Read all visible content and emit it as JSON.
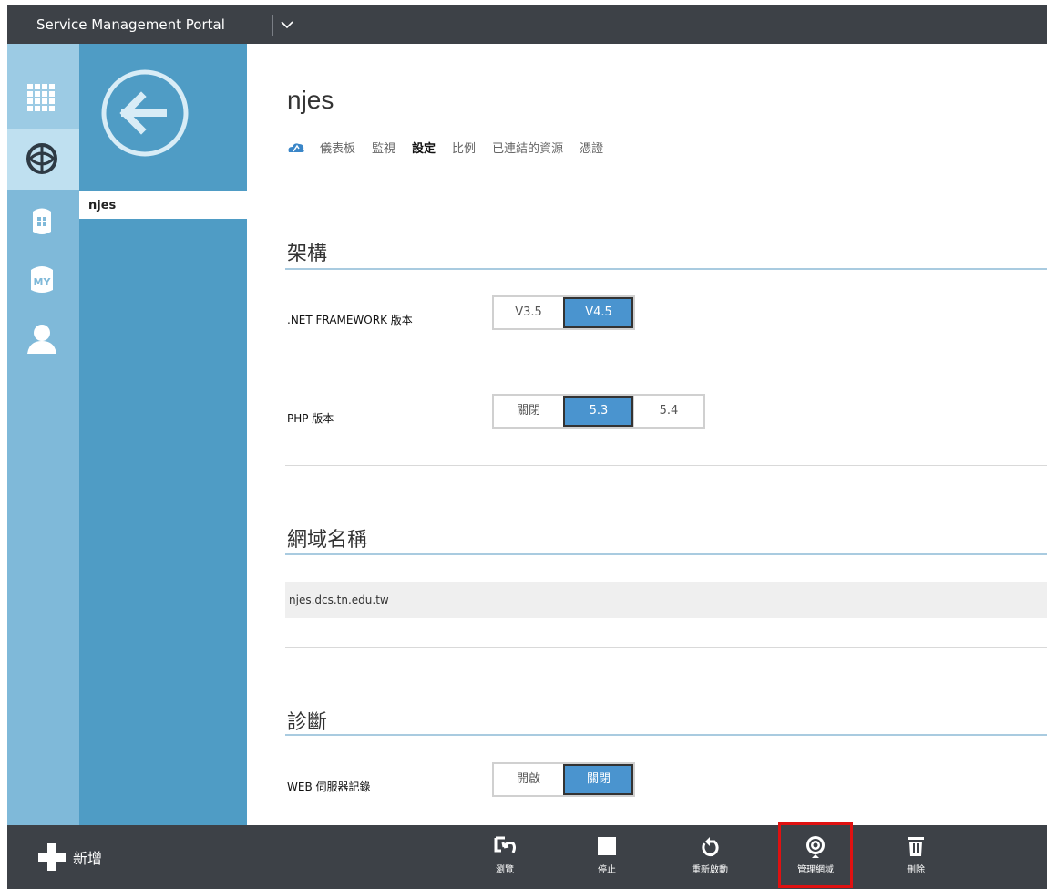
{
  "header": {
    "portal_title": "Service Management Portal"
  },
  "sidebar": {
    "selected_item": "njes"
  },
  "page": {
    "title": "njes",
    "tabs": [
      "儀表板",
      "監視",
      "設定",
      "比例",
      "已連結的資源",
      "憑證"
    ],
    "active_tab": "設定"
  },
  "sections": {
    "framework": {
      "heading": "架構",
      "net_label": ".NET FRAMEWORK 版本",
      "net_options": [
        "V3.5",
        "V4.5"
      ],
      "net_selected": "V4.5",
      "php_label": "PHP 版本",
      "php_options": [
        "關閉",
        "5.3",
        "5.4"
      ],
      "php_selected": "5.3"
    },
    "domain": {
      "heading": "網域名稱",
      "value": "njes.dcs.tn.edu.tw"
    },
    "diagnostics": {
      "heading": "診斷",
      "web_log_label": "WEB 伺服器記錄",
      "web_log_options": [
        "開啟",
        "關閉"
      ],
      "web_log_selected": "關閉"
    }
  },
  "commandbar": {
    "new_label": "新增",
    "commands": [
      "瀏覽",
      "停止",
      "重新啟動",
      "管理網域",
      "刪除"
    ],
    "highlighted": "管理網域"
  },
  "colors": {
    "accent": "#4a94cf",
    "bar": "#3d4147",
    "highlight": "#e01111"
  }
}
